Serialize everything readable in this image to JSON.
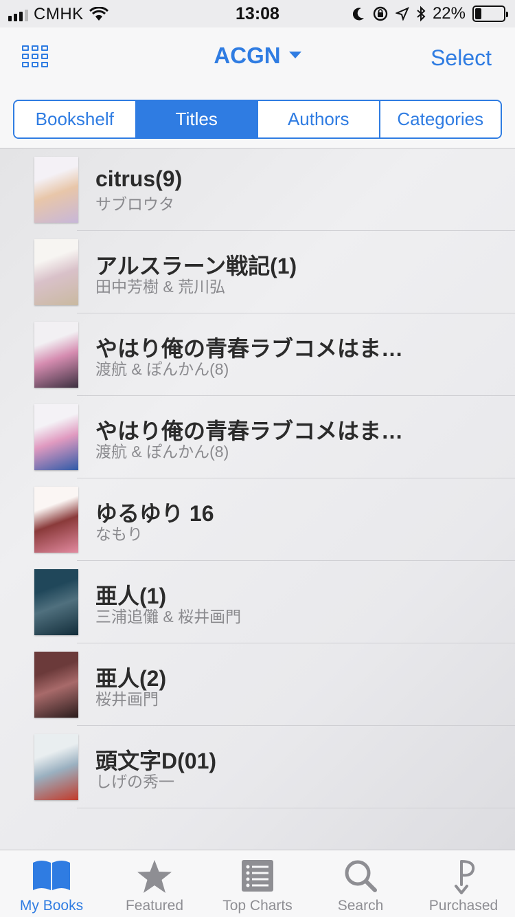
{
  "status": {
    "carrier": "CMHK",
    "time": "13:08",
    "battery": "22%",
    "battery_level": 0.22
  },
  "nav": {
    "title": "ACGN",
    "select_label": "Select"
  },
  "segments": [
    {
      "label": "Bookshelf",
      "active": false
    },
    {
      "label": "Titles",
      "active": true
    },
    {
      "label": "Authors",
      "active": false
    },
    {
      "label": "Categories",
      "active": false
    }
  ],
  "books": [
    {
      "title": "citrus(9)",
      "author": "サブロウタ",
      "cover_colors": [
        "#f4f1f6",
        "#c7b7d9",
        "#e8c6a9"
      ]
    },
    {
      "title": "アルスラーン戦記(1)",
      "author": "田中芳樹 & 荒川弘",
      "cover_colors": [
        "#f7f5f2",
        "#c9b9a0",
        "#d9c1c9"
      ]
    },
    {
      "title": "やはり俺の青春ラブコメはま…",
      "author": "渡航 & ぽんかん(8)",
      "cover_colors": [
        "#f2f0f3",
        "#3c3040",
        "#d58cb0"
      ]
    },
    {
      "title": "やはり俺の青春ラブコメはま…",
      "author": "渡航 & ぽんかん(8)",
      "cover_colors": [
        "#f4f2f6",
        "#2e5aa8",
        "#e09ac0"
      ]
    },
    {
      "title": "ゆるゆり 16",
      "author": "なもり",
      "cover_colors": [
        "#fbf6f4",
        "#e28aa0",
        "#8a3a3a"
      ]
    },
    {
      "title": "亜人(1)",
      "author": "三浦追儺 & 桜井画門",
      "cover_colors": [
        "#20475a",
        "#122d3a",
        "#50707e"
      ]
    },
    {
      "title": "亜人(2)",
      "author": "桜井画門",
      "cover_colors": [
        "#6b3a3a",
        "#2a1c1c",
        "#a86a6a"
      ]
    },
    {
      "title": "頭文字D(01)",
      "author": "しげの秀一",
      "cover_colors": [
        "#e9eef0",
        "#c23a2a",
        "#9ab0c0"
      ]
    }
  ],
  "tabs": [
    {
      "label": "My Books",
      "icon": "book-icon",
      "active": true
    },
    {
      "label": "Featured",
      "icon": "star-icon",
      "active": false
    },
    {
      "label": "Top Charts",
      "icon": "list-icon",
      "active": false
    },
    {
      "label": "Search",
      "icon": "search-icon",
      "active": false
    },
    {
      "label": "Purchased",
      "icon": "purchased-icon",
      "active": false
    }
  ],
  "colors": {
    "accent": "#2f7ce2"
  }
}
